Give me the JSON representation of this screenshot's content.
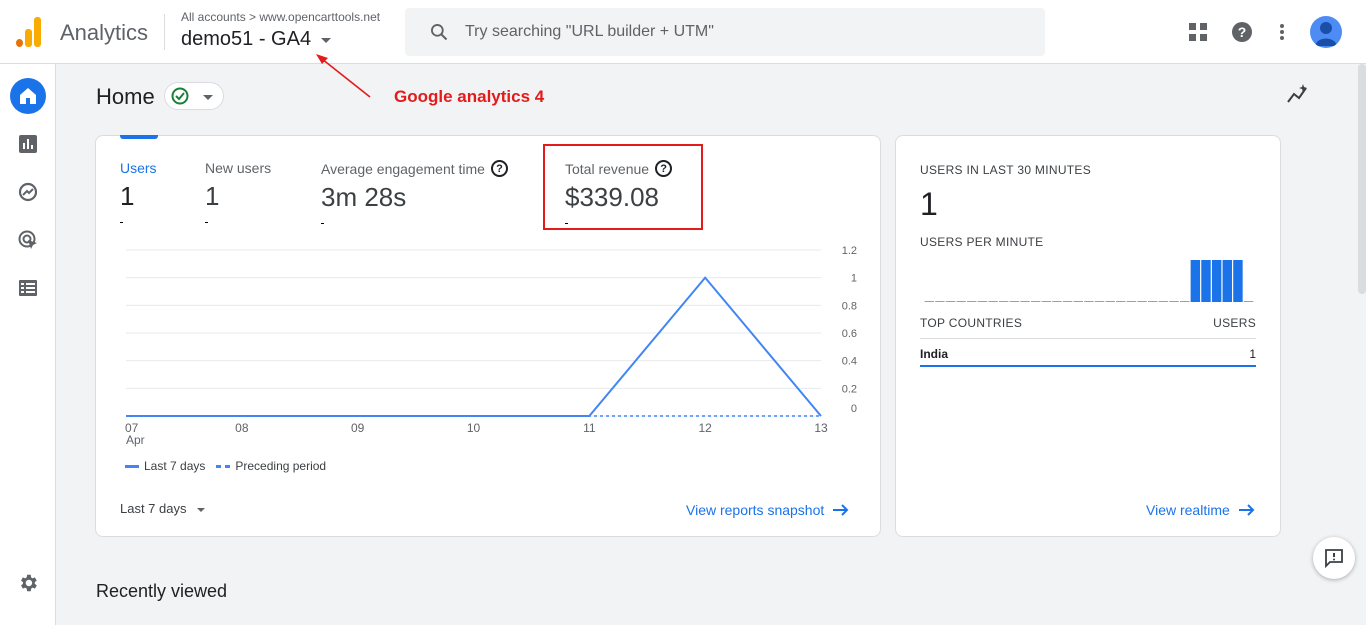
{
  "app": {
    "name": "Analytics",
    "breadcrumb": "All accounts > www.opencarttools.net",
    "property": "demo51 - GA4"
  },
  "search": {
    "placeholder": "Try searching \"URL builder + UTM\""
  },
  "colors": {
    "accent": "#1a73e8",
    "series": "#4285f4",
    "annotation": "#e31b1b"
  },
  "sidebar": {
    "items": [
      {
        "icon": "home-icon",
        "active": true
      },
      {
        "icon": "reports-icon"
      },
      {
        "icon": "explore-icon"
      },
      {
        "icon": "advertising-icon"
      },
      {
        "icon": "configure-icon"
      }
    ],
    "bottom_icon": "settings-gear-icon"
  },
  "page": {
    "title": "Home"
  },
  "annotation": "Google analytics 4",
  "metrics": [
    {
      "label": "Users",
      "value": "1"
    },
    {
      "label": "New users",
      "value": "1"
    },
    {
      "label": "Average engagement time",
      "value": "3m 28s"
    },
    {
      "label": "Total revenue",
      "value": "$339.08"
    }
  ],
  "chart_data": {
    "type": "line",
    "categories": [
      "07",
      "08",
      "09",
      "10",
      "11",
      "12",
      "13"
    ],
    "x_sublabel": "Apr",
    "series": [
      {
        "name": "Last 7 days",
        "values": [
          0,
          0,
          0,
          0,
          0,
          1,
          0
        ],
        "style": "solid"
      },
      {
        "name": "Preceding period",
        "values": [
          0,
          0,
          0,
          0,
          0,
          0,
          0
        ],
        "style": "dashed"
      }
    ],
    "yticks": [
      "1.2",
      "1",
      "0.8",
      "0.6",
      "0.4",
      "0.2",
      "0"
    ],
    "ylim": [
      0,
      1.2
    ],
    "grid": true
  },
  "main_card": {
    "range_label": "Last 7 days",
    "link": "View reports snapshot"
  },
  "realtime": {
    "title": "USERS IN LAST 30 MINUTES",
    "value": "1",
    "per_minute_title": "USERS PER MINUTE",
    "per_minute": [
      0,
      0,
      0,
      0,
      0,
      0,
      0,
      0,
      0,
      0,
      0,
      0,
      0,
      0,
      0,
      0,
      0,
      0,
      0,
      0,
      0,
      0,
      0,
      0,
      0,
      1,
      1,
      1,
      1,
      1,
      0
    ],
    "countries_header": "TOP COUNTRIES",
    "users_header": "USERS",
    "rows": [
      {
        "country": "India",
        "users": "1"
      }
    ],
    "link": "View realtime"
  },
  "recent": {
    "title": "Recently viewed"
  }
}
